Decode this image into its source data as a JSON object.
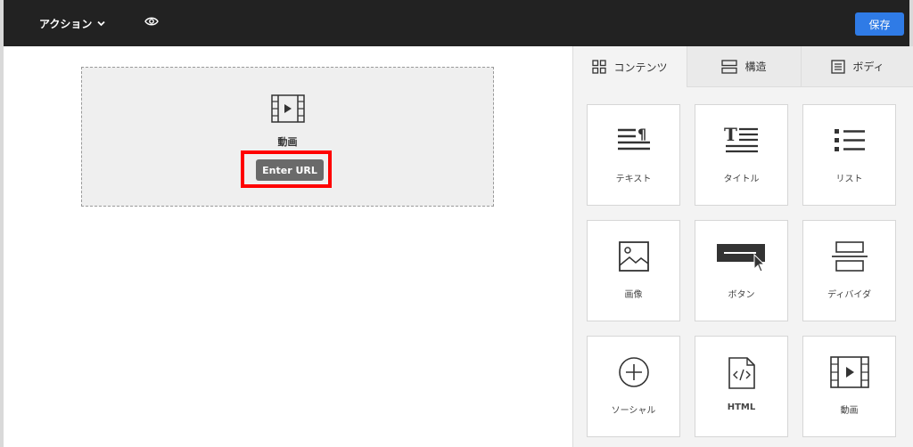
{
  "topbar": {
    "actions_label": "アクション",
    "save_label": "保存",
    "save_color": "#2f7be6"
  },
  "canvas": {
    "video_block": {
      "label": "動画",
      "enter_url_label": "Enter URL",
      "highlight_color": "#ff0000"
    }
  },
  "panel": {
    "tabs": [
      {
        "label": "コンテンツ",
        "icon": "grid-icon",
        "active": true
      },
      {
        "label": "構造",
        "icon": "structure-icon",
        "active": false
      },
      {
        "label": "ボディ",
        "icon": "body-icon",
        "active": false
      }
    ],
    "tiles": [
      {
        "label": "テキスト",
        "icon": "text-icon"
      },
      {
        "label": "タイトル",
        "icon": "title-icon"
      },
      {
        "label": "リスト",
        "icon": "list-icon"
      },
      {
        "label": "画像",
        "icon": "image-icon"
      },
      {
        "label": "ボタン",
        "icon": "button-icon"
      },
      {
        "label": "ディバイダ",
        "icon": "divider-icon"
      },
      {
        "label": "ソーシャル",
        "icon": "social-icon"
      },
      {
        "label": "HTML",
        "icon": "html-icon"
      },
      {
        "label": "動画",
        "icon": "video-icon"
      }
    ]
  }
}
